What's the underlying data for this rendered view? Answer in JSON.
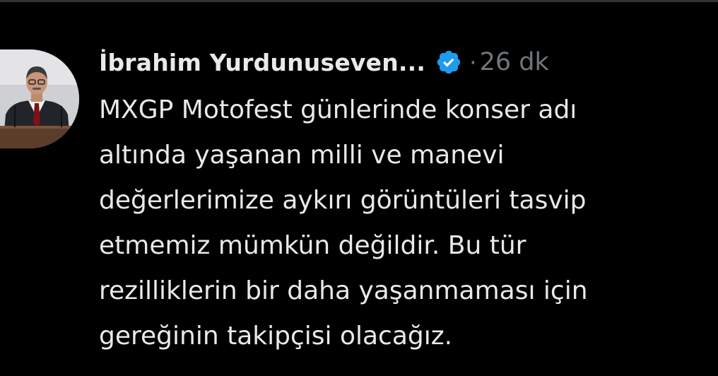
{
  "tweet": {
    "author_name": "İbrahim Yurdunuseven...",
    "separator": "·",
    "time": "26 dk",
    "text": "MXGP Motofest günlerinde konser adı\naltında  yaşanan milli ve manevi\ndeğerlerimize aykırı görüntüleri tasvip\netmemiz mümkün değildir. Bu tür\nrezilliklerin bir daha yaşanmaması için\ngereğinin takipçisi olacağız.",
    "verified_icon": "verified-badge-icon"
  },
  "colors": {
    "background": "#000000",
    "text": "#e7e9ea",
    "muted": "#71767b",
    "verified": "#1d9bf0"
  }
}
